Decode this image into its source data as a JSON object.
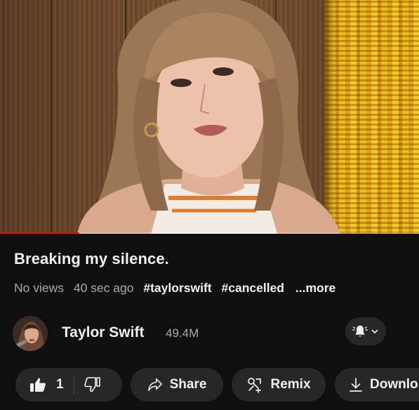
{
  "video": {
    "progress_fraction": 0.19
  },
  "info": {
    "title": "Breaking my silence.",
    "views": "No views",
    "time_ago": "40 sec ago",
    "hashtags": [
      "#taylorswift",
      "#cancelled"
    ],
    "more_label": "...more"
  },
  "channel": {
    "name": "Taylor Swift",
    "subscribers": "49.4M",
    "bell_icon": "bell-ringing-icon",
    "dropdown_icon": "chevron-down-icon"
  },
  "actions": {
    "like_count": "1",
    "share_label": "Share",
    "remix_label": "Remix",
    "download_label": "Downlo"
  },
  "colors": {
    "background": "#0f0f0f",
    "pill": "#272727",
    "progress": "#ff0000",
    "secondary_text": "#aaaaaa"
  }
}
